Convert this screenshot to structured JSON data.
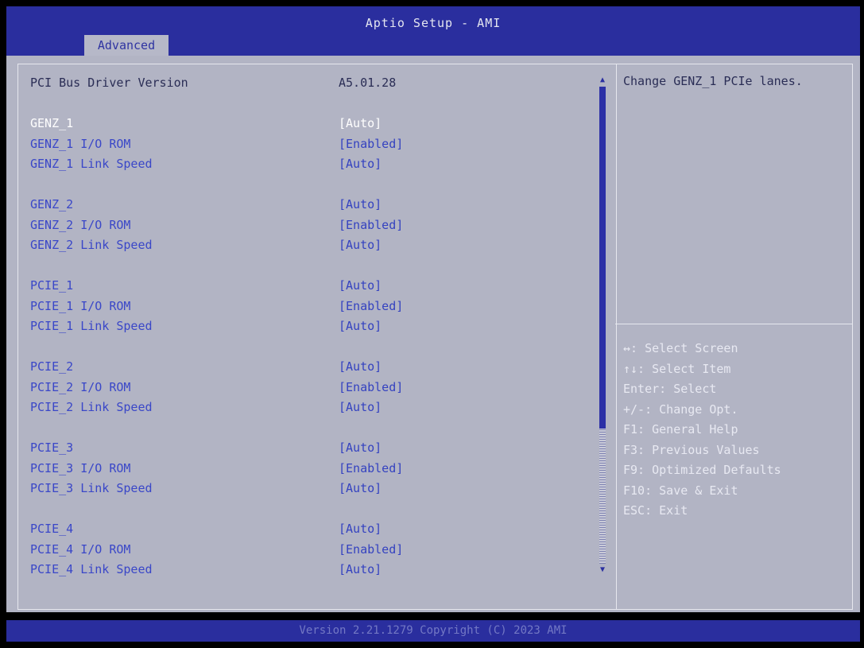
{
  "header": {
    "title": "Aptio Setup - AMI",
    "tab": "Advanced"
  },
  "colors": {
    "header_bg": "#2a2e9e",
    "panel_bg": "#b2b4c4",
    "selected_text": "#ffffff",
    "option_text": "#3a47c8"
  },
  "settings": {
    "driver_version": {
      "label": "PCI Bus Driver Version",
      "value": "A5.01.28"
    },
    "rows": [
      {
        "label": "GENZ_1",
        "value": "[Auto]"
      },
      {
        "label": "GENZ_1 I/O ROM",
        "value": "[Enabled]"
      },
      {
        "label": "GENZ_1 Link Speed",
        "value": "[Auto]"
      },
      {
        "label": "GENZ_2",
        "value": "[Auto]"
      },
      {
        "label": "GENZ_2 I/O ROM",
        "value": "[Enabled]"
      },
      {
        "label": "GENZ_2 Link Speed",
        "value": "[Auto]"
      },
      {
        "label": "PCIE_1",
        "value": "[Auto]"
      },
      {
        "label": "PCIE_1 I/O ROM",
        "value": "[Enabled]"
      },
      {
        "label": "PCIE_1 Link Speed",
        "value": "[Auto]"
      },
      {
        "label": "PCIE_2",
        "value": "[Auto]"
      },
      {
        "label": "PCIE_2 I/O ROM",
        "value": "[Enabled]"
      },
      {
        "label": "PCIE_2 Link Speed",
        "value": "[Auto]"
      },
      {
        "label": "PCIE_3",
        "value": "[Auto]"
      },
      {
        "label": "PCIE_3 I/O ROM",
        "value": "[Enabled]"
      },
      {
        "label": "PCIE_3 Link Speed",
        "value": "[Auto]"
      },
      {
        "label": "PCIE_4",
        "value": "[Auto]"
      },
      {
        "label": "PCIE_4 I/O ROM",
        "value": "[Enabled]"
      },
      {
        "label": "PCIE_4 Link Speed",
        "value": "[Auto]"
      }
    ]
  },
  "scrollbar": {
    "up_glyph": "▲",
    "down_glyph": "▼"
  },
  "help": {
    "text": "Change GENZ_1 PCIe lanes.",
    "keys": [
      "↔: Select Screen",
      "↑↓: Select Item",
      "Enter: Select",
      "+/-: Change Opt.",
      "F1: General Help",
      "F3: Previous Values",
      "F9: Optimized Defaults",
      "F10: Save & Exit",
      "ESC: Exit"
    ]
  },
  "footer": {
    "text": "Version 2.21.1279 Copyright (C) 2023 AMI"
  }
}
